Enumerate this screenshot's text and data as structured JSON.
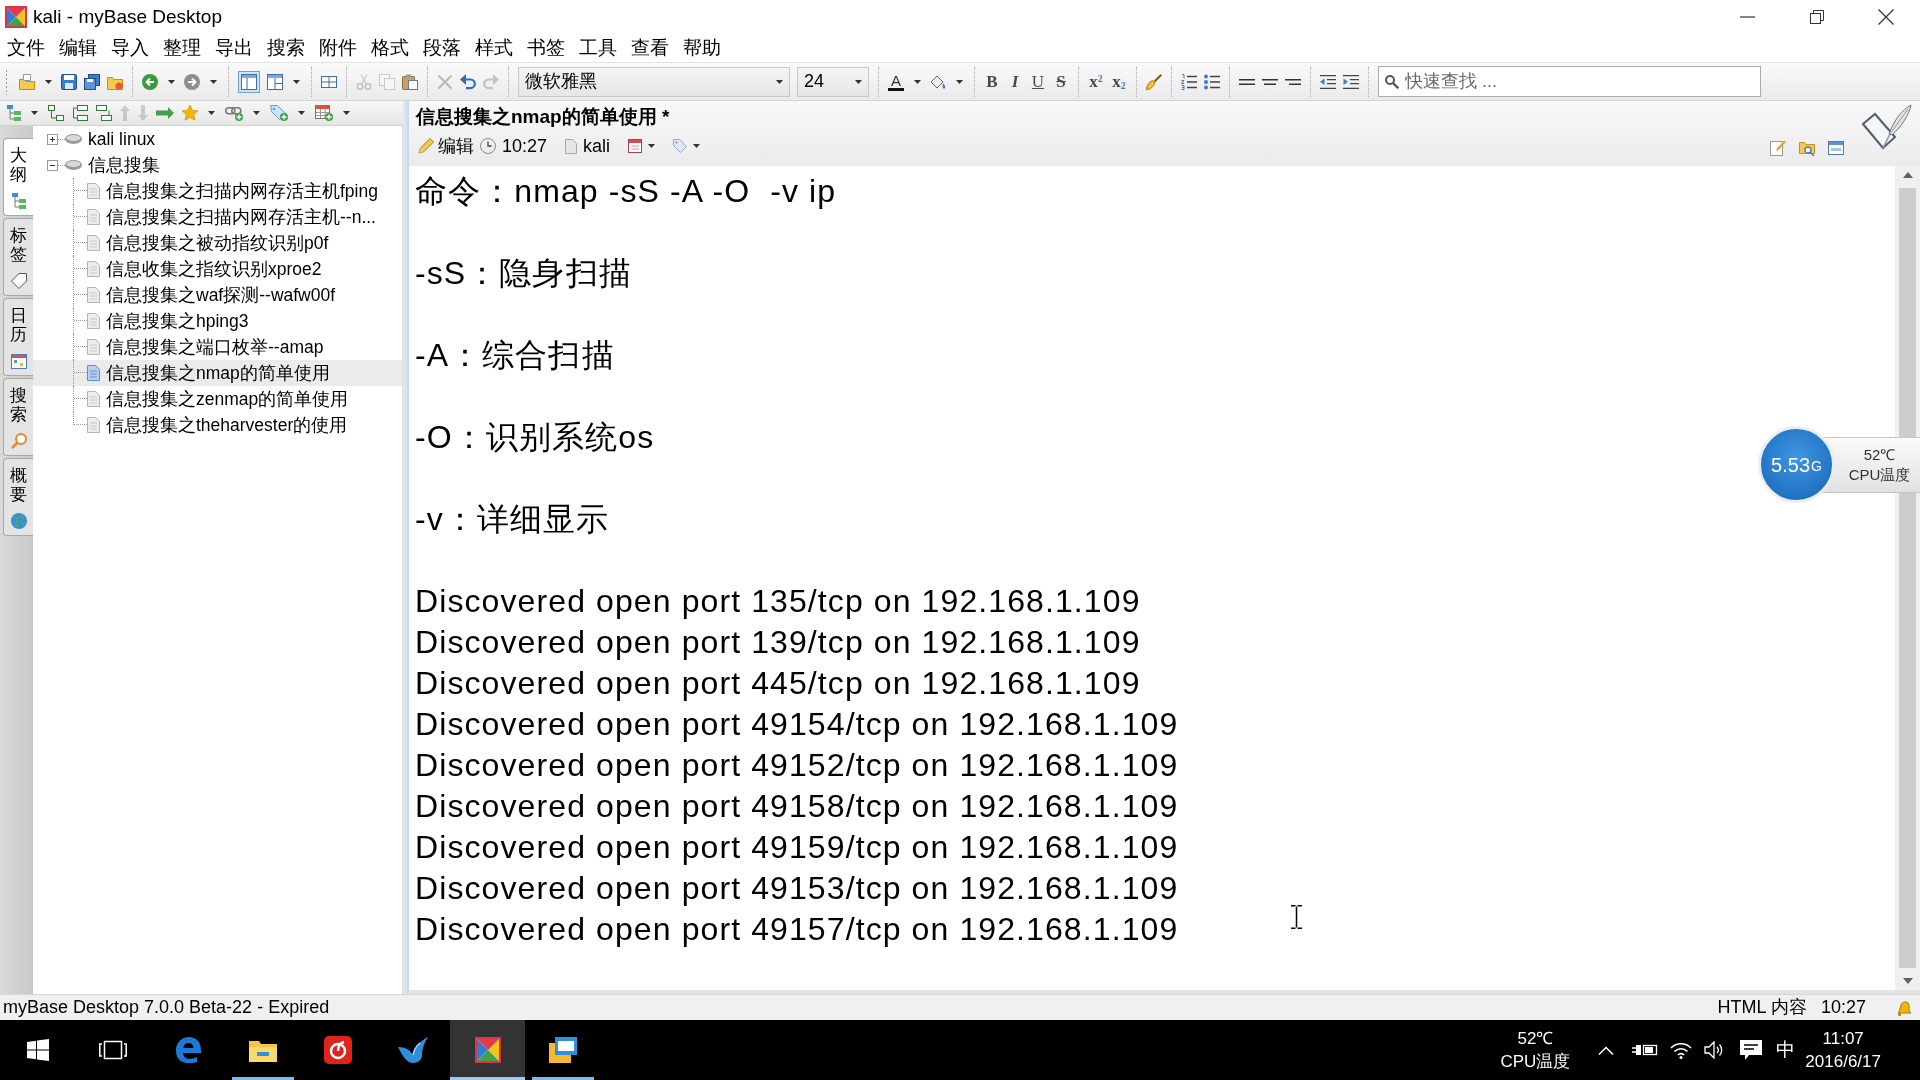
{
  "window": {
    "title": "kali - myBase Desktop"
  },
  "menu": [
    "文件",
    "编辑",
    "导入",
    "整理",
    "导出",
    "搜索",
    "附件",
    "格式",
    "段落",
    "样式",
    "书签",
    "工具",
    "查看",
    "帮助"
  ],
  "toolbar": {
    "groups": [
      [
        {
          "kind": "new",
          "dropdown": true,
          "disabled": false,
          "pressed": false
        },
        {
          "kind": "save",
          "disabled": false,
          "pressed": false
        },
        {
          "kind": "save_all",
          "disabled": false,
          "pressed": false
        },
        {
          "kind": "close",
          "disabled": false,
          "pressed": false
        }
      ],
      [
        {
          "kind": "back",
          "dropdown": true,
          "disabled": false,
          "pressed": false
        },
        {
          "kind": "forward",
          "dropdown": true,
          "disabled": false,
          "pressed": false
        }
      ],
      [
        {
          "kind": "layout",
          "disabled": false,
          "pressed": true
        },
        {
          "kind": "layout2",
          "dropdown": true,
          "disabled": false,
          "pressed": false
        }
      ],
      [
        {
          "kind": "split",
          "disabled": false,
          "pressed": false
        }
      ],
      [
        {
          "kind": "cut",
          "disabled": true,
          "pressed": false
        },
        {
          "kind": "copy",
          "disabled": true,
          "pressed": false
        },
        {
          "kind": "paste",
          "disabled": false,
          "pressed": false
        }
      ],
      [
        {
          "kind": "delete",
          "disabled": true,
          "pressed": false
        },
        {
          "kind": "undo",
          "disabled": false,
          "pressed": false
        },
        {
          "kind": "redo",
          "disabled": true,
          "pressed": false
        }
      ],
      [
        {
          "kind": "font",
          "value": "微软雅黑"
        },
        {
          "kind": "size",
          "value": "24"
        }
      ],
      [
        {
          "kind": "text_color",
          "label": "A",
          "dropdown": true,
          "disabled": false,
          "pressed": false
        },
        {
          "kind": "highlight",
          "dropdown": true,
          "disabled": false,
          "pressed": false
        }
      ],
      [
        {
          "kind": "bold",
          "label": "B",
          "disabled": false,
          "pressed": false
        },
        {
          "kind": "italic",
          "label": "I",
          "disabled": false,
          "pressed": false
        },
        {
          "kind": "underline",
          "label": "U",
          "disabled": false,
          "pressed": false
        },
        {
          "kind": "strike",
          "label": "S",
          "disabled": false,
          "pressed": false
        }
      ],
      [
        {
          "kind": "superscript",
          "label": "x$^{2}$",
          "disabled": false,
          "pressed": false
        },
        {
          "kind": "subscript",
          "label": "x$_{2}$",
          "disabled": false,
          "pressed": false
        }
      ],
      [
        {
          "kind": "clear_format",
          "disabled": false,
          "pressed": false
        }
      ],
      [
        {
          "kind": "numbered_list",
          "disabled": false,
          "pressed": false
        },
        {
          "kind": "bullet_list",
          "disabled": false,
          "pressed": false
        }
      ],
      [
        {
          "kind": "align_left",
          "disabled": false,
          "pressed": false
        },
        {
          "kind": "align_center",
          "disabled": false,
          "pressed": false
        },
        {
          "kind": "align_right",
          "disabled": false,
          "pressed": false
        }
      ],
      [
        {
          "kind": "outdent",
          "disabled": false,
          "pressed": false
        },
        {
          "kind": "indent",
          "disabled": false,
          "pressed": false
        }
      ],
      [
        {
          "kind": "search",
          "placeholder": "快速查找 ..."
        }
      ]
    ]
  },
  "sidebar": {
    "toolbar": [
      {
        "kind": "outline",
        "dropdown": true,
        "disabled": false
      },
      {
        "kind": "node_child",
        "disabled": false
      },
      {
        "kind": "node_sibling",
        "disabled": false
      },
      {
        "kind": "node_parent",
        "disabled": false
      },
      {
        "kind": "move_up",
        "disabled": true
      },
      {
        "kind": "move_down",
        "disabled": true
      },
      {
        "kind": "move",
        "disabled": false
      },
      {
        "kind": "star",
        "dropdown": true,
        "disabled": false
      },
      {
        "kind": "link",
        "dropdown": true,
        "disabled": false
      },
      {
        "kind": "attach",
        "dropdown": true,
        "disabled": false
      },
      {
        "kind": "table",
        "dropdown": true,
        "disabled": false
      }
    ],
    "tabs": [
      {
        "label": "大纲",
        "selected": true
      },
      {
        "label": "标签",
        "selected": false
      },
      {
        "label": "日历",
        "selected": false
      },
      {
        "label": "搜索",
        "selected": false
      },
      {
        "label": "概要",
        "selected": false
      }
    ],
    "tree": [
      {
        "label": "kali linux",
        "expanded": false,
        "selected": false
      },
      {
        "label": "信息搜集",
        "expanded": true,
        "selected": false,
        "children": [
          {
            "label": "信息搜集之扫描内网存活主机fping",
            "selected": false
          },
          {
            "label": "信息搜集之扫描内网存活主机--n...",
            "selected": false
          },
          {
            "label": "信息搜集之被动指纹识别p0f",
            "selected": false
          },
          {
            "label": "信息收集之指纹识别xproe2",
            "selected": false
          },
          {
            "label": "信息搜集之waf探测--wafw00f",
            "selected": false
          },
          {
            "label": "信息搜集之hping3",
            "selected": false
          },
          {
            "label": "信息搜集之端口枚举--amap",
            "selected": false
          },
          {
            "label": "信息搜集之nmap的简单使用",
            "selected": true
          },
          {
            "label": "信息搜集之zenmap的简单使用",
            "selected": false
          },
          {
            "label": "信息搜集之theharvester的使用",
            "selected": false
          }
        ]
      }
    ]
  },
  "note": {
    "title": "信息搜集之nmap的简单使用 *",
    "edit": "编辑",
    "time": "10:27",
    "owner": "kali",
    "sections": [
      {
        "lines": [
          "命令：nmap -sS -A -O  -v ip"
        ]
      },
      {
        "lines": [
          "-sS：隐身扫描"
        ]
      },
      {
        "lines": [
          "-A：综合扫描"
        ]
      },
      {
        "lines": [
          "-O：识别系统os"
        ]
      },
      {
        "lines": [
          "-v：详细显示"
        ]
      },
      {
        "lines": [
          "Discovered open port 135/tcp on 192.168.1.109",
          "Discovered open port 139/tcp on 192.168.1.109",
          "Discovered open port 445/tcp on 192.168.1.109",
          "Discovered open port 49154/tcp on 192.168.1.109",
          "Discovered open port 49152/tcp on 192.168.1.109",
          "Discovered open port 49158/tcp on 192.168.1.109",
          "Discovered open port 49159/tcp on 192.168.1.109",
          "Discovered open port 49153/tcp on 192.168.1.109",
          "Discovered open port 49157/tcp on 192.168.1.109"
        ]
      }
    ]
  },
  "cpu_widget": {
    "frequency": "5.53",
    "unit": "G",
    "temperature": "52℃",
    "label": "CPU温度"
  },
  "status_bar": {
    "text": "myBase Desktop 7.0.0 Beta-22 - Expired",
    "format": "HTML 内容",
    "time": "10:27"
  },
  "taskbar": {
    "apps": [
      {
        "kind": "start",
        "running": false,
        "selected": false
      },
      {
        "kind": "task_view",
        "running": false,
        "selected": false
      },
      {
        "kind": "edge",
        "running": false,
        "selected": false
      },
      {
        "kind": "explorer",
        "running": true,
        "selected": false
      },
      {
        "kind": "music",
        "running": false,
        "selected": false
      },
      {
        "kind": "bird",
        "running": false,
        "selected": false
      },
      {
        "kind": "mybase",
        "running": true,
        "selected": true
      },
      {
        "kind": "mail",
        "running": true,
        "selected": false
      }
    ],
    "tray": {
      "temperature": "52℃",
      "label": "CPU温度",
      "input_method": "中",
      "time": "11:07",
      "date": "2016/6/17"
    }
  }
}
